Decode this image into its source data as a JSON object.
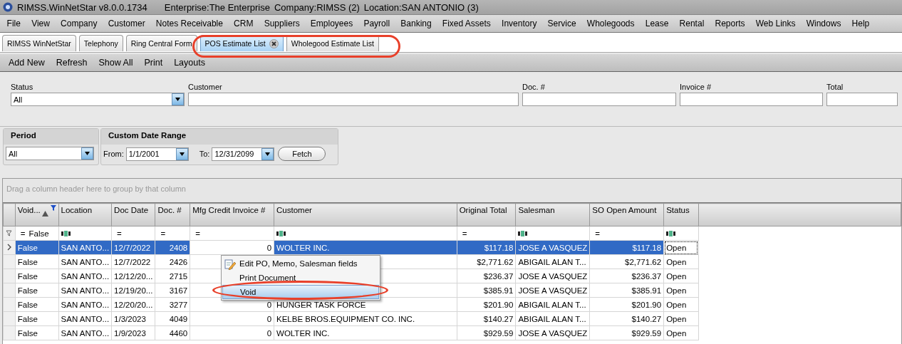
{
  "window": {
    "title": "RIMSS.WinNetStar v8.0.0.1734",
    "enterprise": "Enterprise:The Enterprise",
    "company": "Company:RIMSS (2)",
    "location": "Location:SAN ANTONIO (3)"
  },
  "menu": [
    "File",
    "View",
    "Company",
    "Customer",
    "Notes Receivable",
    "CRM",
    "Suppliers",
    "Employees",
    "Payroll",
    "Banking",
    "Fixed Assets",
    "Inventory",
    "Service",
    "Wholegoods",
    "Lease",
    "Rental",
    "Reports",
    "Web Links",
    "Windows",
    "Help"
  ],
  "tabs": [
    {
      "label": "RIMSS WinNetStar",
      "selected": false,
      "closable": false
    },
    {
      "label": "Telephony",
      "selected": false,
      "closable": false
    },
    {
      "label": "Ring Central Form",
      "selected": false,
      "closable": false
    },
    {
      "label": "POS Estimate List",
      "selected": true,
      "closable": true
    },
    {
      "label": "Wholegood Estimate List",
      "selected": false,
      "closable": false
    }
  ],
  "toolbar": [
    "Add New",
    "Refresh",
    "Show All",
    "Print",
    "Layouts"
  ],
  "filters": [
    {
      "label": "Status",
      "kind": "dropdown",
      "value": "All"
    },
    {
      "label": "Customer",
      "kind": "text"
    },
    {
      "label": "Doc. #",
      "kind": "text"
    },
    {
      "label": "Invoice #",
      "kind": "text"
    },
    {
      "label": "Total",
      "kind": "text"
    }
  ],
  "period": {
    "title": "Period",
    "value": "All"
  },
  "date_range": {
    "title": "Custom Date Range",
    "from_label": "From:",
    "from": "1/1/2001",
    "to_label": "To:",
    "to": "12/31/2099",
    "button": "Fetch"
  },
  "grid": {
    "group_hint": "Drag a column header here to group by that column",
    "columns": [
      {
        "label": "Void...",
        "sorted": true,
        "filtered": true
      },
      {
        "label": "Location",
        "sorted": false,
        "filtered": false
      },
      {
        "label": "Doc Date",
        "sorted": false,
        "filtered": false
      },
      {
        "label": "Doc. #",
        "sorted": false,
        "filtered": false
      },
      {
        "label": "Mfg Credit Invoice #",
        "sorted": false,
        "filtered": false
      },
      {
        "label": "Customer",
        "sorted": false,
        "filtered": false
      },
      {
        "label": "Original Total",
        "sorted": false,
        "filtered": false
      },
      {
        "label": "Salesman",
        "sorted": false,
        "filtered": false
      },
      {
        "label": "SO Open Amount",
        "sorted": false,
        "filtered": false
      },
      {
        "label": "Status",
        "sorted": false,
        "filtered": false
      }
    ],
    "filter_row": [
      {
        "kind": "equals",
        "op": "=",
        "value": "False"
      },
      {
        "kind": "text"
      },
      {
        "kind": "equals",
        "op": "="
      },
      {
        "kind": "equals",
        "op": "="
      },
      {
        "kind": "equals",
        "op": "="
      },
      {
        "kind": "text"
      },
      {
        "kind": "equals",
        "op": "="
      },
      {
        "kind": "text"
      },
      {
        "kind": "equals",
        "op": "="
      },
      {
        "kind": "text"
      }
    ],
    "rows": [
      {
        "selected": true,
        "cells": [
          "False",
          "SAN ANTO...",
          "12/7/2022",
          "2408",
          "0",
          "WOLTER INC.",
          "$117.18",
          "JOSE A VASQUEZ",
          "$117.18",
          "Open"
        ]
      },
      {
        "selected": false,
        "cells": [
          "False",
          "SAN ANTO...",
          "12/7/2022",
          "2426",
          null,
          null,
          "$2,771.62",
          "ABIGAIL ALAN T...",
          "$2,771.62",
          "Open"
        ]
      },
      {
        "selected": false,
        "cells": [
          "False",
          "SAN ANTO...",
          "12/12/20...",
          "2715",
          null,
          null,
          "$236.37",
          "JOSE A VASQUEZ",
          "$236.37",
          "Open"
        ]
      },
      {
        "selected": false,
        "cells": [
          "False",
          "SAN ANTO...",
          "12/19/20...",
          "3167",
          null,
          null,
          "$385.91",
          "JOSE A VASQUEZ",
          "$385.91",
          "Open"
        ]
      },
      {
        "selected": false,
        "cells": [
          "False",
          "SAN ANTO...",
          "12/20/20...",
          "3277",
          "0",
          "HUNGER TASK FORCE",
          "$201.90",
          "ABIGAIL ALAN T...",
          "$201.90",
          "Open"
        ]
      },
      {
        "selected": false,
        "cells": [
          "False",
          "SAN ANTO...",
          "1/3/2023",
          "4049",
          "0",
          "KELBE BROS.EQUIPMENT CO. INC.",
          "$140.27",
          "ABIGAIL ALAN T...",
          "$140.27",
          "Open"
        ]
      },
      {
        "selected": false,
        "cells": [
          "False",
          "SAN ANTO...",
          "1/9/2023",
          "4460",
          "0",
          "WOLTER INC.",
          "$929.59",
          "JOSE A VASQUEZ",
          "$929.59",
          "Open"
        ]
      }
    ]
  },
  "context_menu": {
    "items": [
      {
        "label": "Edit PO, Memo, Salesman fields",
        "icon": true,
        "highlighted": false
      },
      {
        "label": "Print Document",
        "icon": false,
        "highlighted": false
      },
      {
        "label": "Void",
        "icon": false,
        "highlighted": true
      }
    ]
  },
  "annotations": [
    {
      "kind": "ellipse"
    },
    {
      "kind": "ellipse"
    }
  ]
}
